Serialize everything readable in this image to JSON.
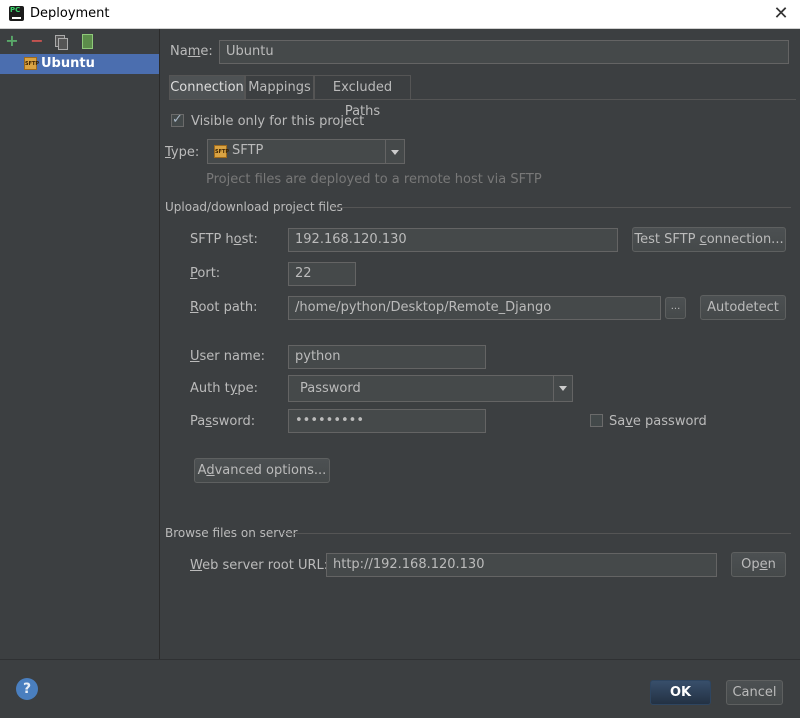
{
  "window": {
    "title": "Deployment",
    "close_glyph": "✕",
    "icon": "pycharm-app-icon"
  },
  "sidebar": {
    "toolbar": [
      {
        "name": "add-icon",
        "glyph": "+"
      },
      {
        "name": "remove-icon",
        "glyph": "−"
      },
      {
        "name": "copy-icon",
        "glyph": ""
      },
      {
        "name": "use-as-default-icon",
        "glyph": ""
      }
    ],
    "selected_item": {
      "label": "Ubuntu",
      "icon_text": "SFTP"
    }
  },
  "main": {
    "name_label_pre": "Na",
    "name_label_u": "m",
    "name_label_post": "e:",
    "name_value": "Ubuntu",
    "tabs": [
      {
        "label": "Connection",
        "active": true
      },
      {
        "label": "Mappings",
        "active": false
      },
      {
        "label": "Excluded Paths",
        "active": false
      }
    ],
    "visible_only_label": "Visible only for this project",
    "visible_only_checked": true,
    "type_label_u": "T",
    "type_label_post": "ype:",
    "type_value": "SFTP",
    "type_hint": "Project files are deployed to a remote host via SFTP",
    "upload_section": "Upload/download project files",
    "sftp_host_label_pre": "SFTP h",
    "sftp_host_label_u": "o",
    "sftp_host_label_post": "st:",
    "sftp_host_value": "192.168.120.130",
    "test_button_pre": "Test SFTP ",
    "test_button_u": "c",
    "test_button_post": "onnection...",
    "port_label_u": "P",
    "port_label_post": "ort:",
    "port_value": "22",
    "root_path_label_u": "R",
    "root_path_label_post": "oot path:",
    "root_path_value": "/home/python/Desktop/Remote_Django",
    "browse_button": "...",
    "autodetect_button": "Autodetect",
    "user_name_label_u": "U",
    "user_name_label_post": "ser name:",
    "user_name_value": "python",
    "auth_type_label_pre": "Auth t",
    "auth_type_label_u": "y",
    "auth_type_label_post": "pe:",
    "auth_type_value": "Password",
    "password_label_pre": "Pa",
    "password_label_u": "s",
    "password_label_post": "sword:",
    "password_value": "•••••••••",
    "save_password_pre": "Sa",
    "save_password_u": "v",
    "save_password_post": "e password",
    "save_password_checked": false,
    "advanced_button_pre": "A",
    "advanced_button_u": "d",
    "advanced_button_post": "vanced options...",
    "browse_section": "Browse files on server",
    "web_root_label_u": "W",
    "web_root_label_post": "eb server root URL:",
    "web_root_value": "http://192.168.120.130",
    "open_button_pre": "Op",
    "open_button_u": "e",
    "open_button_post": "n"
  },
  "footer": {
    "help_glyph": "?",
    "ok_label": "OK",
    "cancel_label": "Cancel"
  },
  "colors": {
    "background": "#3c3f41",
    "selection": "#4b6eaf",
    "field_bg": "#45494a",
    "text": "#bbbbbb",
    "hint": "#787878",
    "primary_button": "#2e4560"
  }
}
